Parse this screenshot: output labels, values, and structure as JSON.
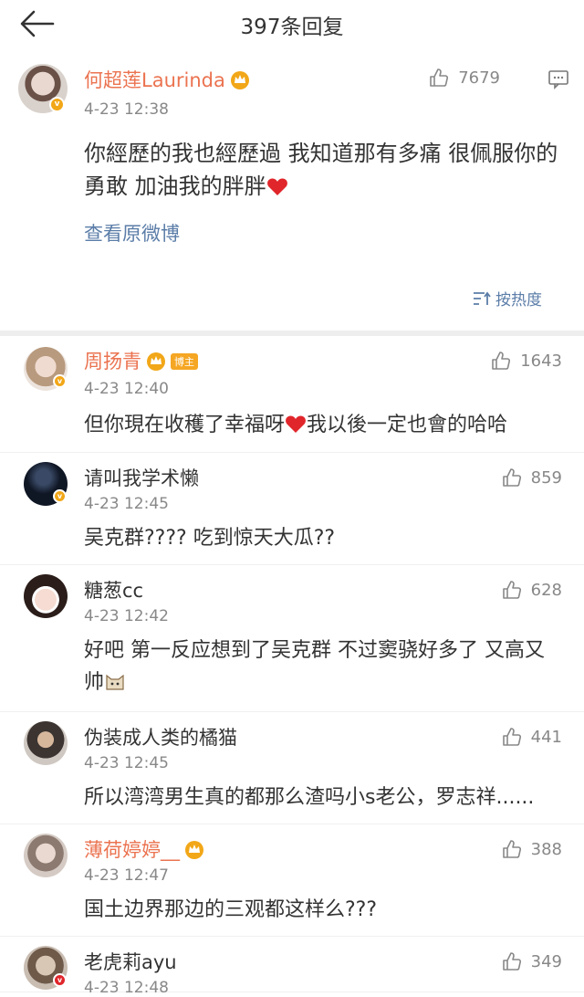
{
  "header": {
    "title": "397条回复"
  },
  "main_comment": {
    "name": "何超莲Laurinda",
    "time": "4-23 12:38",
    "likes": "7679",
    "text": "你經歷的我也經歷過 我知道那有多痛 很佩服你的勇敢 加油我的胖胖",
    "view_original": "查看原微博",
    "sort_label": "按热度"
  },
  "replies": [
    {
      "name": "周扬青",
      "tag": "博主",
      "time": "4-23 12:40",
      "likes": "1643",
      "text": "但你現在收穫了幸福呀",
      "text2": "我以後一定也會的哈哈"
    },
    {
      "name": "请叫我学术懒",
      "time": "4-23 12:45",
      "likes": "859",
      "text": "吴克群???? 吃到惊天大瓜??"
    },
    {
      "name": "糖葱cc",
      "time": "4-23 12:42",
      "likes": "628",
      "text": "好吧 第一反应想到了吴克群 不过窦骁好多了 又高又帅"
    },
    {
      "name": "伪装成人类的橘猫",
      "time": "4-23 12:45",
      "likes": "441",
      "text": "所以湾湾男生真的都那么渣吗小s老公，罗志祥......"
    },
    {
      "name": "薄荷婷婷__",
      "time": "4-23 12:47",
      "likes": "388",
      "text": "国土边界那边的三观都这样么???"
    },
    {
      "name": "老虎莉ayu",
      "time": "4-23 12:48",
      "likes": "349"
    }
  ],
  "colors": {
    "name_orange": "#eb7350",
    "link_blue": "#5b7da8",
    "gold": "#f2a718"
  }
}
